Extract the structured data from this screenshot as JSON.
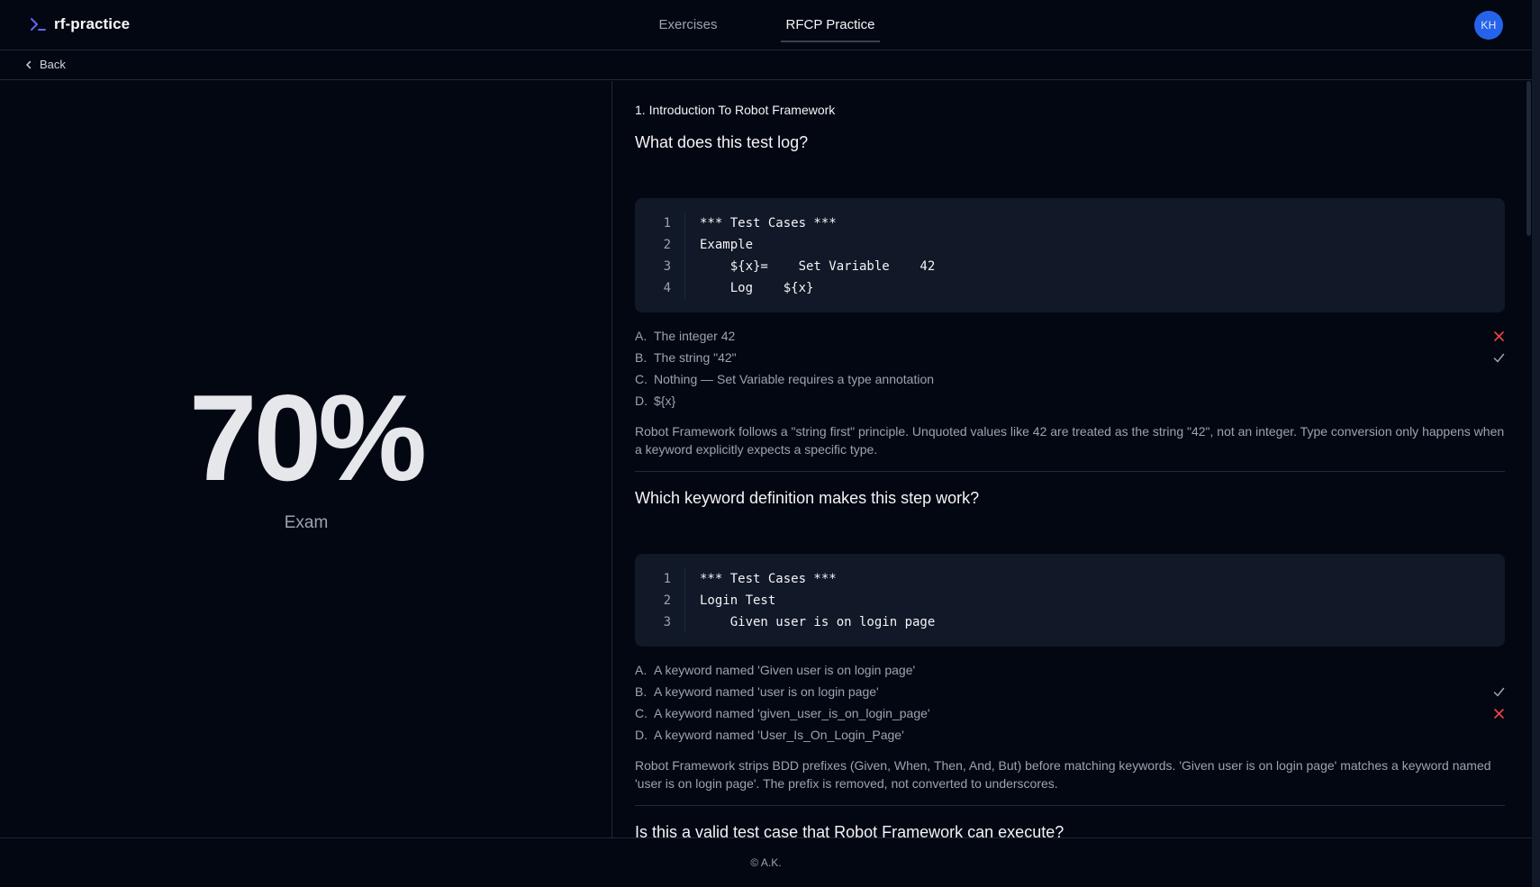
{
  "app": {
    "name": "rf-practice"
  },
  "nav": {
    "items": [
      {
        "label": "Exercises"
      },
      {
        "label": "RFCP Practice"
      }
    ]
  },
  "user": {
    "initials": "KH"
  },
  "back": {
    "label": "Back"
  },
  "result": {
    "score": "70%",
    "label": "Exam"
  },
  "section": {
    "title": "1. Introduction To Robot Framework"
  },
  "questions": [
    {
      "title": "What does this test log?",
      "code": [
        {
          "n": "1",
          "text": "*** Test Cases ***"
        },
        {
          "n": "2",
          "text": "Example"
        },
        {
          "n": "3",
          "text": "    ${x}=    Set Variable    42"
        },
        {
          "n": "4",
          "text": "    Log    ${x}"
        }
      ],
      "answers": [
        {
          "letter": "A.",
          "text": "The integer 42",
          "mark": "wrong"
        },
        {
          "letter": "B.",
          "text": "The string \"42\"",
          "mark": "correct"
        },
        {
          "letter": "C.",
          "text": "Nothing — Set Variable requires a type annotation",
          "mark": ""
        },
        {
          "letter": "D.",
          "text": "${x}",
          "mark": ""
        }
      ],
      "explanation": "Robot Framework follows a \"string first\" principle. Unquoted values like 42 are treated as the string \"42\", not an integer. Type conversion only happens when a keyword explicitly expects a specific type."
    },
    {
      "title": "Which keyword definition makes this step work?",
      "code": [
        {
          "n": "1",
          "text": "*** Test Cases ***"
        },
        {
          "n": "2",
          "text": "Login Test"
        },
        {
          "n": "3",
          "text": "    Given user is on login page"
        }
      ],
      "answers": [
        {
          "letter": "A.",
          "text": "A keyword named 'Given user is on login page'",
          "mark": ""
        },
        {
          "letter": "B.",
          "text": "A keyword named 'user is on login page'",
          "mark": "correct"
        },
        {
          "letter": "C.",
          "text": "A keyword named 'given_user_is_on_login_page'",
          "mark": "wrong"
        },
        {
          "letter": "D.",
          "text": "A keyword named 'User_Is_On_Login_Page'",
          "mark": ""
        }
      ],
      "explanation": "Robot Framework strips BDD prefixes (Given, When, Then, And, But) before matching keywords. 'Given user is on login page' matches a keyword named 'user is on login page'. The prefix is removed, not converted to underscores."
    },
    {
      "title": "Is this a valid test case that Robot Framework can execute?"
    }
  ],
  "footer": {
    "text": "© A.K."
  },
  "colors": {
    "background": "#030712",
    "accent": "#2563eb",
    "wrong": "#ef4444",
    "correct": "#9ca3af"
  }
}
